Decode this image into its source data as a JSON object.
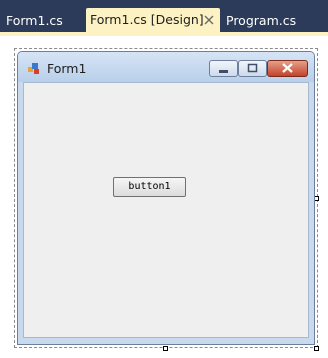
{
  "tabs": [
    {
      "label": "Form1.cs",
      "active": false
    },
    {
      "label": "Form1.cs [Design]",
      "active": true
    },
    {
      "label": "Program.cs",
      "active": false
    }
  ],
  "form": {
    "title": "Form1",
    "buttons": [
      {
        "label": "button1"
      }
    ]
  },
  "colors": {
    "tab_strip": "#2b3b59",
    "active_tab": "#fdf2c4",
    "form_border": "#c9d9ee",
    "client_area": "#efefef"
  }
}
